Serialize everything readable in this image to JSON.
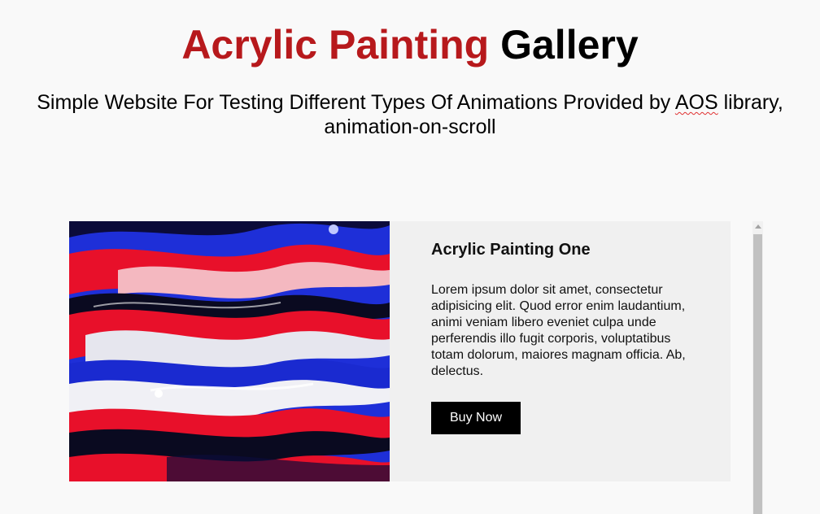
{
  "header": {
    "title_accent": "Acrylic Painting",
    "title_plain": "Gallery",
    "subtitle_part1": "Simple Website For Testing Different Types Of Animations Provided by ",
    "subtitle_aos": "AOS",
    "subtitle_part2": " library, animation-on-scroll"
  },
  "card": {
    "image_alt": "Acrylic painting with red, blue and white swirls",
    "title": "Acrylic Painting One",
    "text": "Lorem ipsum dolor sit amet, consectetur adipisicing elit. Quod error enim laudantium, animi veniam libero eveniet culpa unde perferendis illo fugit corporis, voluptatibus totam dolorum, maiores magnam officia. Ab, delectus.",
    "button_label": "Buy Now"
  },
  "colors": {
    "accent": "#b7191c",
    "background": "#f9f9f9",
    "card_background": "#f0f0f0",
    "button_background": "#000000"
  }
}
